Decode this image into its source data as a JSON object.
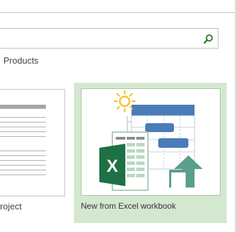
{
  "search": {
    "value": "",
    "placeholder": "",
    "icon": "search-icon",
    "icon_color": "#2e7d32"
  },
  "category": {
    "label": "Products"
  },
  "templates": [
    {
      "caption": "roject"
    },
    {
      "caption": "New from Excel workbook",
      "selected": true
    }
  ],
  "colors": {
    "selected_bg": "#d4e8cf",
    "excel_green": "#1e7145",
    "gantt_blue": "#4a7cb8",
    "arrow_teal": "#5a9e8c",
    "sun_yellow": "#f2c530"
  }
}
